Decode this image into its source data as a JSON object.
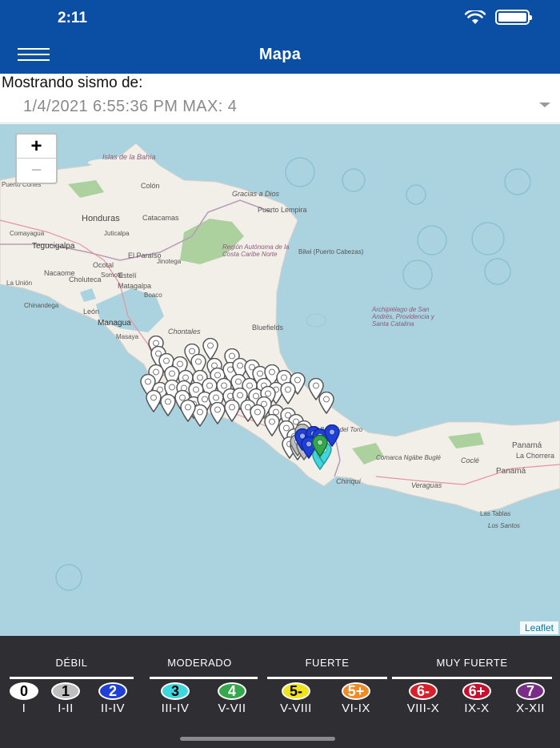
{
  "status": {
    "time": "2:11"
  },
  "header": {
    "title": "Mapa"
  },
  "selector": {
    "label": "Mostrando sismo de:",
    "value": "1/4/2021 6:55:36 PM MAX: 4"
  },
  "map": {
    "zoom_in": "+",
    "zoom_out": "−",
    "attribution": "Leaflet",
    "places": [
      "Islas de la Bahía",
      "Colón",
      "Gracias a Dios",
      "Honduras",
      "Catacamas",
      "Puerto Lempira",
      "Puerto Cortés",
      "Comayagua",
      "Tegucigalpa",
      "Juticalpa",
      "Región Autónoma de la Costa Caribe Norte",
      "Bilwi (Puerto Cabezas)",
      "El Paraíso",
      "Jinotega",
      "Ocotal",
      "Choluteca",
      "Nacaome",
      "Somoto",
      "La Unión",
      "Estelí",
      "Matagalpa",
      "Chinandega",
      "León",
      "Boaco",
      "Managua",
      "Masaya",
      "Chontales",
      "Bluefields",
      "Archipiélago de San Andrés, Providencia y Santa Catalina",
      "Bocas del Toro",
      "Panamá",
      "La Chorrera",
      "Comarca Ngäbe Buglé",
      "Coclé",
      "Panamá",
      "Chiriquí",
      "Veraguas",
      "Las Tablas",
      "Los Santos"
    ]
  },
  "legend": {
    "categories": [
      "DÉBIL",
      "MODERADO",
      "FUERTE",
      "MUY FUERTE"
    ],
    "levels": [
      {
        "badge": "0",
        "label": "I",
        "color": "#ffffff",
        "text_color": "#000000"
      },
      {
        "badge": "1",
        "label": "I-II",
        "color": "#bfbfbf",
        "text_color": "#000000"
      },
      {
        "badge": "2",
        "label": "II-IV",
        "color": "#1f3fd6",
        "text_color": "#ffffff"
      },
      {
        "badge": "3",
        "label": "III-IV",
        "color": "#3fd6de",
        "text_color": "#000000"
      },
      {
        "badge": "4",
        "label": "V-VII",
        "color": "#34a84a",
        "text_color": "#ffffff"
      },
      {
        "badge": "5-",
        "label": "V-VIII",
        "color": "#f0e21c",
        "text_color": "#000000"
      },
      {
        "badge": "5+",
        "label": "VI-IX",
        "color": "#f08a24",
        "text_color": "#ffffff"
      },
      {
        "badge": "6-",
        "label": "VIII-X",
        "color": "#d8202a",
        "text_color": "#ffffff"
      },
      {
        "badge": "6+",
        "label": "IX-X",
        "color": "#c8102e",
        "text_color": "#ffffff"
      },
      {
        "badge": "7",
        "label": "X-XII",
        "color": "#7a2d86",
        "text_color": "#ffffff"
      }
    ]
  },
  "colors": {
    "header": "#0a4fa3",
    "water": "#aad3df",
    "land": "#f2efe9",
    "legend_bg": "#2e2e33"
  }
}
